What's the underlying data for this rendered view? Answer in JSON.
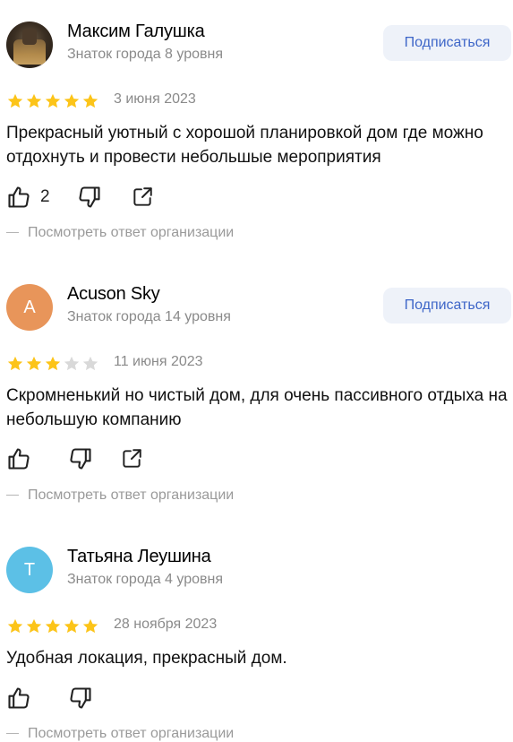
{
  "reviews": [
    {
      "author": "Максим Галушка",
      "level": "Знаток города 8 уровня",
      "avatar": {
        "type": "photo",
        "letter": ""
      },
      "subscribe_label": "Подписаться",
      "rating": 5,
      "date": "3 июня 2023",
      "text": "Прекрасный уютный с хорошой планировкой дом где можно отдохнуть и провести небольшые мероприятия",
      "likes": "2",
      "show_share": true,
      "org_reply_label": "Посмотреть ответ организации"
    },
    {
      "author": "Acuson Sky",
      "level": "Знаток города 14 уровня",
      "avatar": {
        "type": "letter",
        "letter": "A",
        "color": "#e8955a"
      },
      "subscribe_label": "Подписаться",
      "rating": 3,
      "date": "11 июня 2023",
      "text": "Скромненький но чистый дом, для очень пассивного отдыха на небольшую компанию",
      "likes": "",
      "show_share": true,
      "org_reply_label": "Посмотреть ответ организации"
    },
    {
      "author": "Татьяна Леушина",
      "level": "Знаток города 4 уровня",
      "avatar": {
        "type": "letter",
        "letter": "Т",
        "color": "#5cc0e6"
      },
      "subscribe_label": "",
      "rating": 5,
      "date": "28 ноября 2023",
      "text": "Удобная локация, прекрасный дом.",
      "likes": "",
      "show_share": false,
      "org_reply_label": "Посмотреть ответ организации"
    }
  ],
  "colors": {
    "star_filled": "#fcc419",
    "star_empty": "#d9d9d9",
    "accent": "#3e66c8",
    "muted": "#8a8a8a"
  }
}
